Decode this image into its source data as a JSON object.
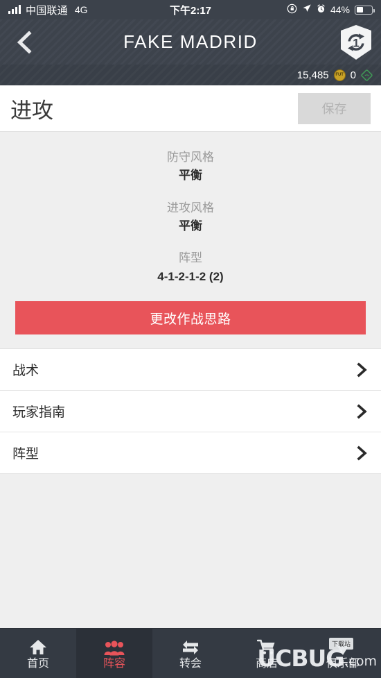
{
  "status_bar": {
    "carrier": "中国联通",
    "network": "4G",
    "time": "下午2:17",
    "battery_percent": "44%",
    "icons": [
      "signal-bars-icon",
      "rotation-lock-icon",
      "location-arrow-icon",
      "alarm-clock-icon",
      "battery-icon"
    ]
  },
  "header": {
    "title": "FAKE MADRID",
    "back_icon": "back-chevron-icon",
    "badge_icon": "squad-refresh-badge-icon",
    "badge_count": "1",
    "background_color": "#3e444e"
  },
  "currency_bar": {
    "coins": "15,485",
    "coin_icon": "fut-coin-icon",
    "coin_icon_label": "FUT",
    "points": "0",
    "point_icon": "fifa-point-diamond-icon",
    "background_color": "#3a4049"
  },
  "title_row": {
    "page_title": "进攻",
    "save_label": "保存",
    "save_disabled": true
  },
  "info": {
    "items": [
      {
        "label": "防守风格",
        "value": "平衡"
      },
      {
        "label": "进攻风格",
        "value": "平衡"
      },
      {
        "label": "阵型",
        "value": "4-1-2-1-2 (2)"
      }
    ]
  },
  "cta": {
    "label": "更改作战思路",
    "color": "#e8545a"
  },
  "list": {
    "rows": [
      {
        "label": "战术",
        "chevron": "chevron-right-icon"
      },
      {
        "label": "玩家指南",
        "chevron": "chevron-right-icon"
      },
      {
        "label": "阵型",
        "chevron": "chevron-right-icon"
      }
    ]
  },
  "bottom_nav": {
    "active_index": 1,
    "active_color": "#e8545a",
    "items": [
      {
        "label": "首页",
        "icon": "home-icon"
      },
      {
        "label": "阵容",
        "icon": "squad-people-icon"
      },
      {
        "label": "转会",
        "icon": "transfer-arrows-icon"
      },
      {
        "label": "商店",
        "icon": "shopping-cart-icon"
      },
      {
        "label": "俱乐部",
        "icon": "club-crest-icon"
      }
    ]
  },
  "watermark": {
    "text": "UCBUG",
    "suffix": ".com",
    "badge": "下载站"
  }
}
